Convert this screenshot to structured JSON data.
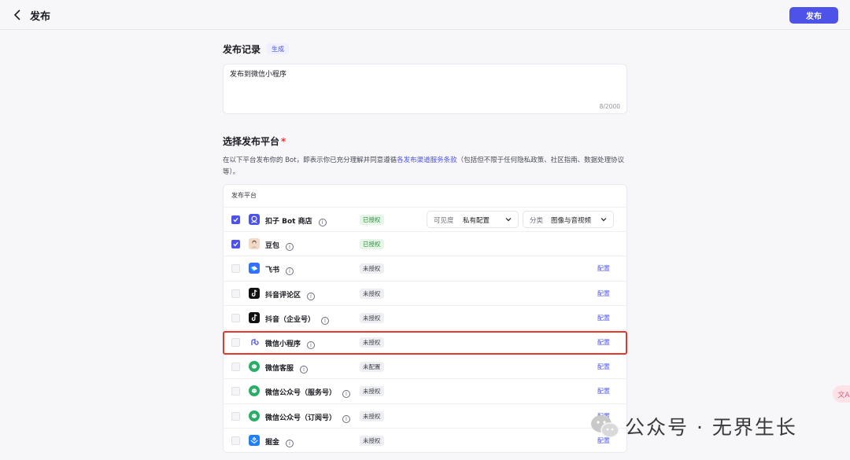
{
  "header": {
    "title": "发布",
    "publish_label": "发布"
  },
  "record": {
    "title": "发布记录",
    "generate_label": "生成",
    "text": "发布到微信小程序",
    "count": "8/2000"
  },
  "platform_section": {
    "title": "选择发布平台",
    "required_mark": "*",
    "desc_before": "在以下平台发布你的 Bot，即表示你已充分理解并同意遵循",
    "desc_link": "各发布渠道服务条款",
    "desc_after": "（包括但不限于任何隐私政策、社区指南、数据处理协议等）。",
    "table_header": "发布平台",
    "visibility_label": "可见度",
    "visibility_value": "私有配置",
    "category_label": "分类",
    "category_value": "图像与音视频"
  },
  "platforms": [
    {
      "name": "扣子 Bot 商店",
      "status": "已授权",
      "checked": true,
      "icon": "coze-bot-icon",
      "color": "#4d53e8",
      "config": ""
    },
    {
      "name": "豆包",
      "status": "已授权",
      "checked": true,
      "icon": "doubao-avatar-icon",
      "color": "#f3d9c8",
      "config": ""
    },
    {
      "name": "飞书",
      "status": "未授权",
      "checked": false,
      "icon": "feishu-icon",
      "color": "#3370ff",
      "config": "配置"
    },
    {
      "name": "抖音评论区",
      "status": "未授权",
      "checked": false,
      "icon": "douyin-icon",
      "color": "#111111",
      "config": "配置"
    },
    {
      "name": "抖音（企业号）",
      "status": "未授权",
      "checked": false,
      "icon": "douyin-icon",
      "color": "#111111",
      "config": "配置"
    },
    {
      "name": "微信小程序",
      "status": "未授权",
      "checked": false,
      "icon": "wechat-miniprogram-icon",
      "color": "#6467f2",
      "config": "配置"
    },
    {
      "name": "微信客服",
      "status": "未配置",
      "checked": false,
      "icon": "wechat-icon",
      "color": "#2aae67",
      "config": "配置"
    },
    {
      "name": "微信公众号（服务号）",
      "status": "未授权",
      "checked": false,
      "icon": "wechat-icon",
      "color": "#2aae67",
      "config": "配置"
    },
    {
      "name": "微信公众号（订阅号）",
      "status": "未授权",
      "checked": false,
      "icon": "wechat-icon",
      "color": "#2aae67",
      "config": "配置"
    },
    {
      "name": "掘金",
      "status": "未授权",
      "checked": false,
      "icon": "juejin-icon",
      "color": "#1e80ff",
      "config": "配置"
    }
  ],
  "watermark": {
    "text": "公众号 · 无界生长"
  },
  "float": {
    "label": "文A"
  },
  "colors": {
    "accent": "#4d53e8",
    "highlight": "#e3392c"
  }
}
